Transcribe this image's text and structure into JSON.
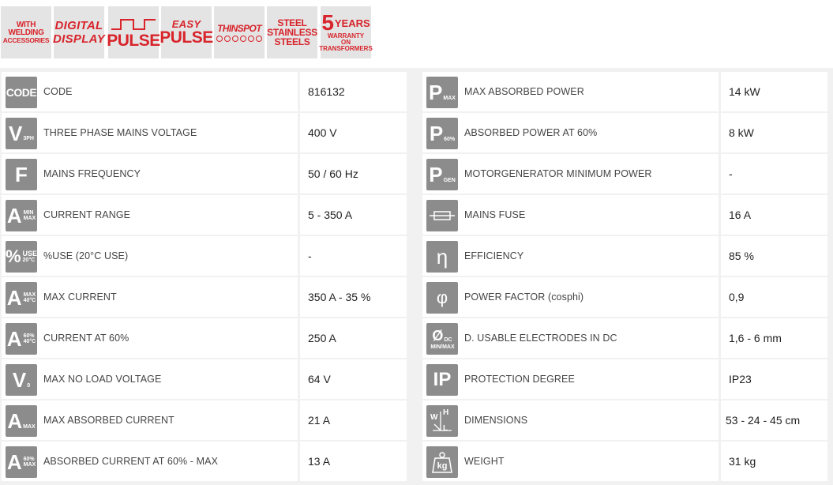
{
  "badges": {
    "accessories": {
      "line1": "WITH",
      "line2": "WELDING",
      "line3": "ACCESSORIES"
    },
    "digital": {
      "line1": "DIGITAL",
      "line2": "DISPLAY"
    },
    "pulse": {
      "label": "PULSE"
    },
    "easy_pulse": {
      "line1": "EASY",
      "line2": "PULSE"
    },
    "thinspot": {
      "label": "THINSPOT"
    },
    "stainless": {
      "line1": "STEEL",
      "line2": "STAINLESS",
      "line3": "STEELS"
    },
    "warranty": {
      "num": "5",
      "word": "YEARS",
      "line2": "WARRANTY",
      "line3": "ON",
      "line4": "TRANSFORMERS"
    },
    "accent_color": "#d8242b",
    "background_color": "#e4e4e4"
  },
  "icons": {
    "code": "CODE",
    "v3ph_main": "V",
    "v3ph_sub": "3PH",
    "freq": "F",
    "range_main": "A",
    "range_sub1": "MIN",
    "range_sub2": "MAX",
    "use_main": "%",
    "use_sub1": "USE",
    "use_sub2": "20°C",
    "maxcur_main": "A",
    "maxcur_sub1": "MAX",
    "maxcur_sub2": "40°C",
    "cur60_main": "A",
    "cur60_sub1": "60%",
    "cur60_sub2": "40°C",
    "v0_main": "V",
    "v0_sub": "0",
    "amax_main": "A",
    "amax_sub": "MAX",
    "a60_main": "A",
    "a60_sub1": "60%",
    "a60_sub2": "MAX",
    "pmax_main": "P",
    "pmax_sub": "MAX",
    "p60_main": "P",
    "p60_sub": "60%",
    "pgen_main": "P",
    "pgen_sub": "GEN",
    "eta": "η",
    "phi": "φ",
    "electrode_main": "Ø",
    "electrode_sub1": "DC",
    "electrode_sub2": "MIN/MAX",
    "ip": "IP",
    "dim_w": "W",
    "dim_h": "H",
    "dim_l": "L",
    "weight": "kg",
    "icon_color": "#8c8c8c"
  },
  "left_rows": [
    {
      "label": "CODE",
      "value": "816132"
    },
    {
      "label": "THREE PHASE MAINS VOLTAGE",
      "value": "400 V"
    },
    {
      "label": "MAINS FREQUENCY",
      "value": "50 / 60 Hz"
    },
    {
      "label": "CURRENT RANGE",
      "value": "5 - 350 A"
    },
    {
      "label": "%USE (20°C USE)",
      "value": "-"
    },
    {
      "label": "MAX CURRENT",
      "value": "350 A - 35 %"
    },
    {
      "label": "CURRENT AT 60%",
      "value": "250 A"
    },
    {
      "label": "MAX NO LOAD VOLTAGE",
      "value": "64 V"
    },
    {
      "label": "MAX ABSORBED CURRENT",
      "value": "21 A"
    },
    {
      "label": "ABSORBED CURRENT AT 60% - MAX",
      "value": "13 A"
    }
  ],
  "right_rows": [
    {
      "label": "MAX ABSORBED POWER",
      "value": "14 kW"
    },
    {
      "label": "ABSORBED POWER AT 60%",
      "value": "8 kW"
    },
    {
      "label": "MOTORGENERATOR MINIMUM POWER",
      "value": "-"
    },
    {
      "label": "MAINS FUSE",
      "value": "16 A"
    },
    {
      "label": "EFFICIENCY",
      "value": "85 %"
    },
    {
      "label": "POWER FACTOR (cosphi)",
      "value": "0,9"
    },
    {
      "label": "D. USABLE ELECTRODES IN DC",
      "value": "1,6 - 6 mm"
    },
    {
      "label": "PROTECTION DEGREE",
      "value": "IP23"
    },
    {
      "label": "DIMENSIONS",
      "value": "53 - 24 - 45 cm"
    },
    {
      "label": "WEIGHT",
      "value": "31 kg"
    }
  ]
}
